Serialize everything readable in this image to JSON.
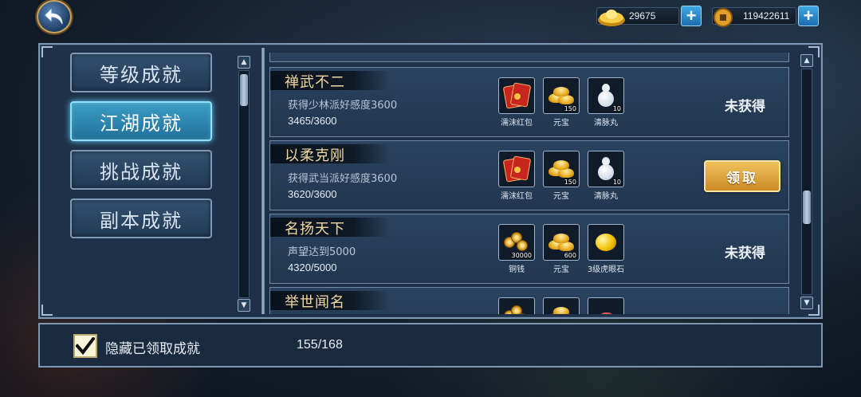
{
  "currency": {
    "gold_ingot_amount": "29675",
    "coin_amount": "119422611"
  },
  "categories": [
    {
      "label": "等级成就",
      "active": false
    },
    {
      "label": "江湖成就",
      "active": true
    },
    {
      "label": "挑战成就",
      "active": false
    },
    {
      "label": "副本成就",
      "active": false
    }
  ],
  "achievements": [
    {
      "title": "禅武不二",
      "description": "获得少林派好感度3600",
      "progress": "3465/3600",
      "status": "未获得",
      "rewards": [
        {
          "name": "濡沫红包",
          "icon": "red-packet-icon",
          "qty": ""
        },
        {
          "name": "元宝",
          "icon": "gold-ingot-icon",
          "qty": "150"
        },
        {
          "name": "清脉丸",
          "icon": "gourd-icon",
          "qty": "10"
        }
      ]
    },
    {
      "title": "以柔克刚",
      "description": "获得武当派好感度3600",
      "progress": "3620/3600",
      "claim_label": "领取",
      "rewards": [
        {
          "name": "濡沫红包",
          "icon": "red-packet-icon",
          "qty": ""
        },
        {
          "name": "元宝",
          "icon": "gold-ingot-icon",
          "qty": "150"
        },
        {
          "name": "清脉丸",
          "icon": "gourd-icon",
          "qty": "10"
        }
      ]
    },
    {
      "title": "名扬天下",
      "description": "声望达到5000",
      "progress": "4320/5000",
      "status": "未获得",
      "rewards": [
        {
          "name": "铜钱",
          "icon": "copper-coins-icon",
          "qty": "30000"
        },
        {
          "name": "元宝",
          "icon": "gold-ingot-icon",
          "qty": "600"
        },
        {
          "name": "3级虎眼石",
          "icon": "tiger-eye-stone-icon",
          "qty": ""
        }
      ]
    },
    {
      "title": "举世闻名",
      "rewards": [
        {
          "name": "",
          "icon": "copper-coins-icon",
          "qty": ""
        },
        {
          "name": "",
          "icon": "gold-ingot-icon",
          "qty": ""
        },
        {
          "name": "",
          "icon": "red-gem-icon",
          "qty": ""
        }
      ]
    }
  ],
  "bottom": {
    "hide_claimed_label": "隐藏已领取成就",
    "hide_claimed_checked": true,
    "total_count": "155/168"
  }
}
